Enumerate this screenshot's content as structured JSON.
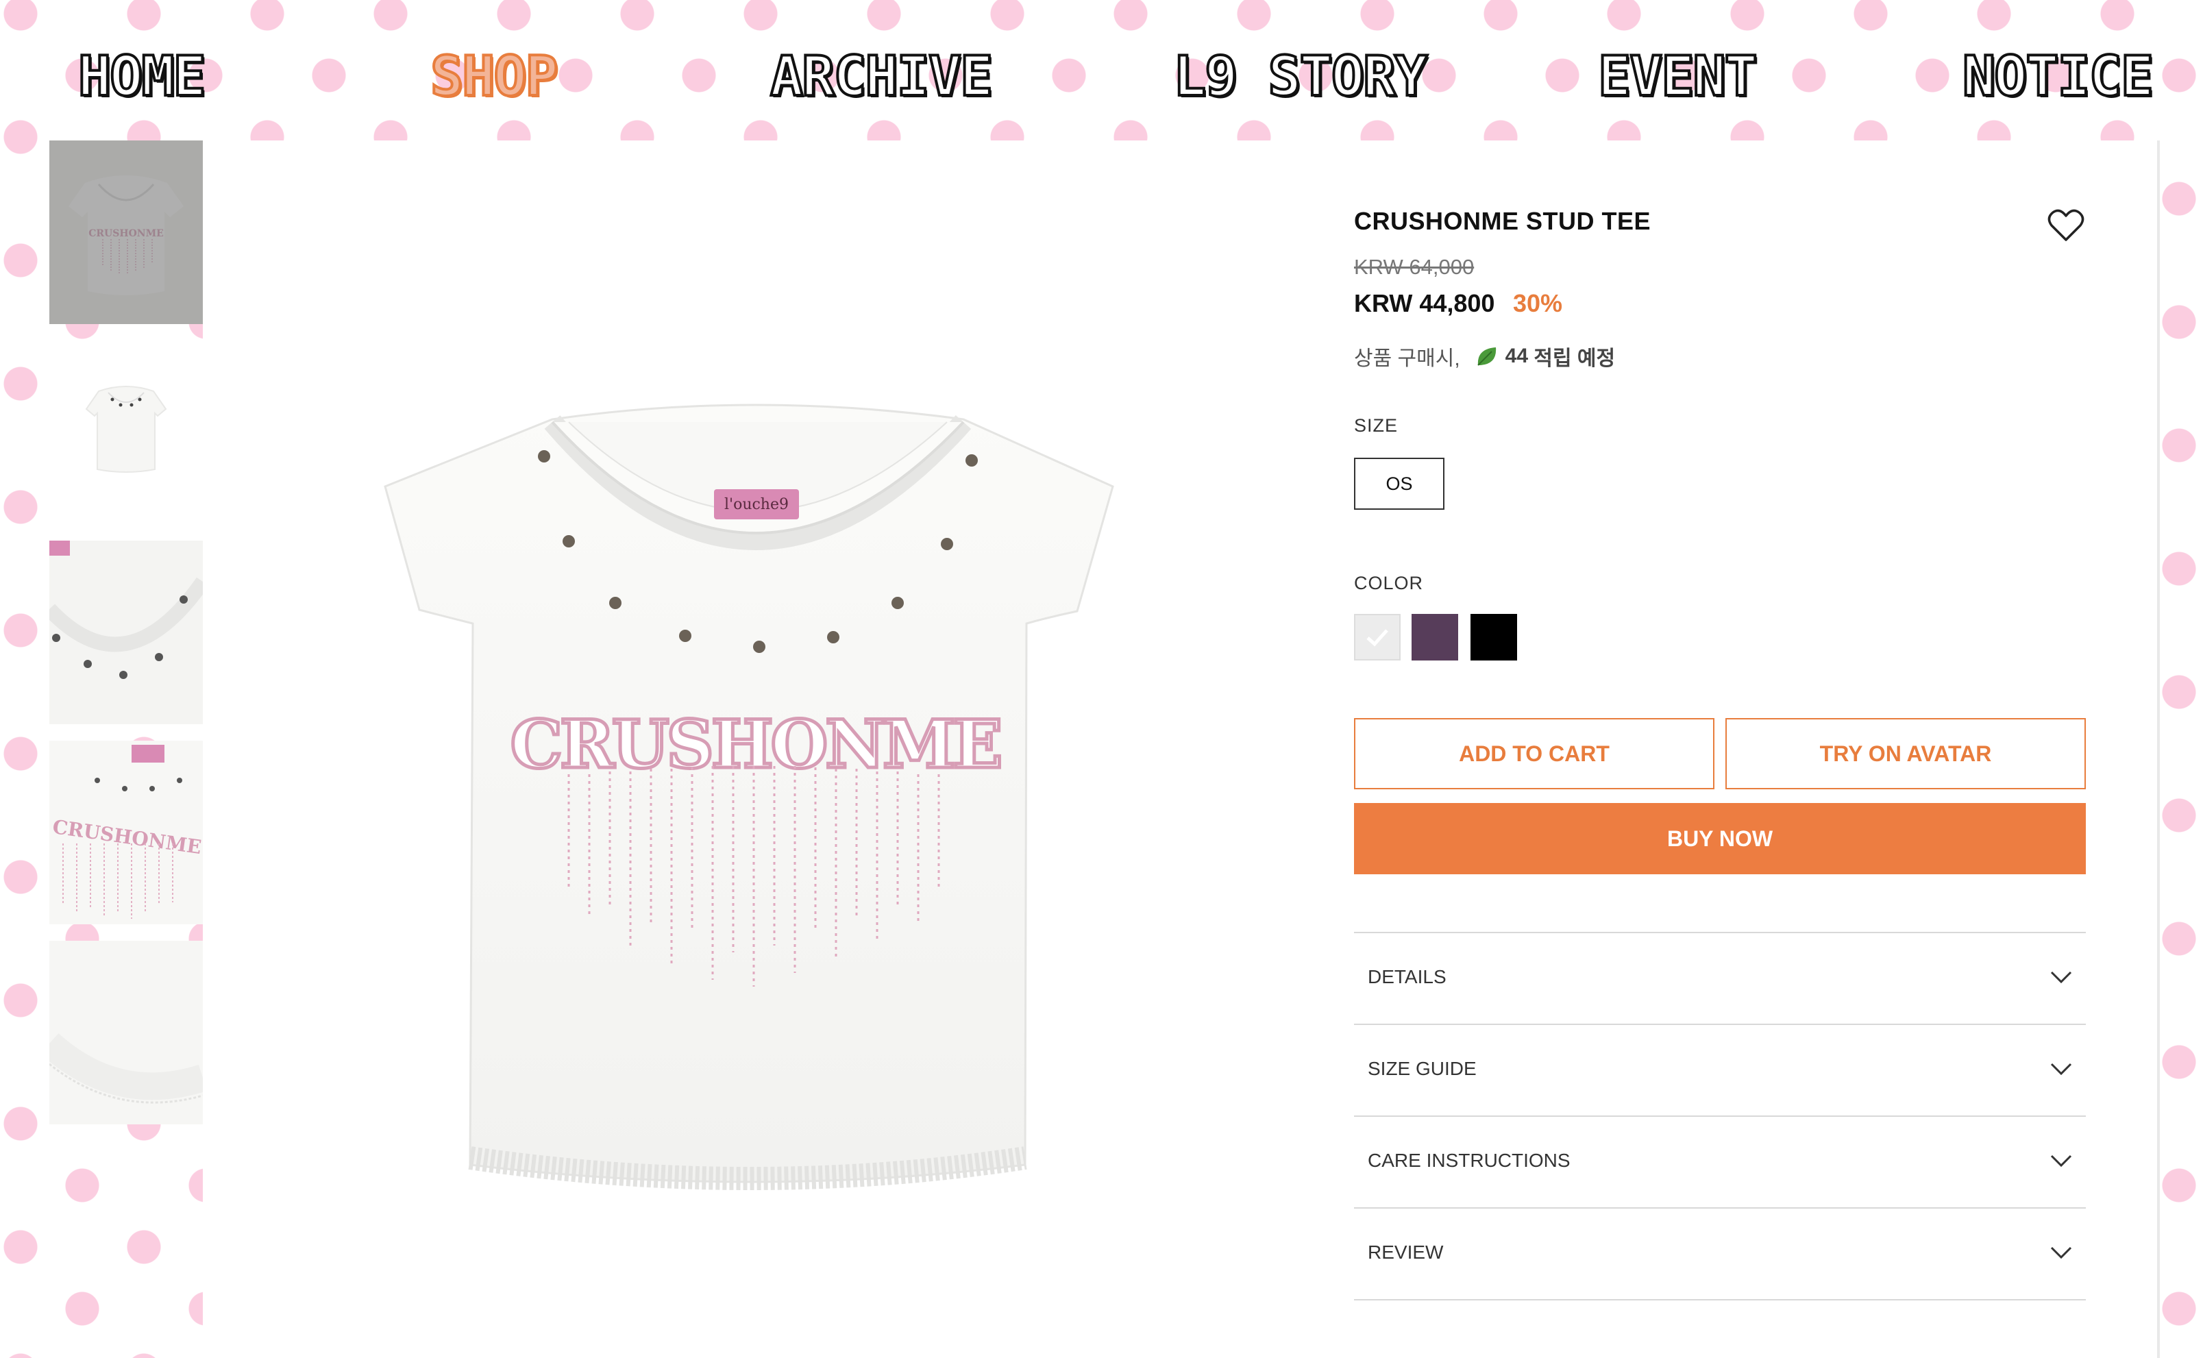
{
  "nav": {
    "items": [
      {
        "label": "HOME",
        "active": false
      },
      {
        "label": "SHOP",
        "active": true
      },
      {
        "label": "ARCHIVE",
        "active": false
      },
      {
        "label": "L9 STORY",
        "active": false
      },
      {
        "label": "EVENT",
        "active": false
      },
      {
        "label": "NOTICE",
        "active": false
      }
    ]
  },
  "product": {
    "title": "CRUSHONME STUD TEE",
    "original_price": "KRW 64,000",
    "sale_price": "KRW 44,800",
    "discount": "30%",
    "points_prefix": "상품 구매시,",
    "points_amount": "44",
    "points_suffix": "적립 예정",
    "size_label": "SIZE",
    "sizes": [
      "OS"
    ],
    "color_label": "COLOR",
    "colors": [
      {
        "name": "white",
        "hex": "#ececec",
        "selected": true
      },
      {
        "name": "purple",
        "hex": "#573d5a",
        "selected": false
      },
      {
        "name": "black",
        "hex": "#000000",
        "selected": false
      }
    ],
    "graphic_text": "CRUSHONME",
    "tag_text": "l'ouche9"
  },
  "actions": {
    "add_to_cart": "ADD TO CART",
    "try_on_avatar": "TRY ON AVATAR",
    "buy_now": "BUY NOW"
  },
  "accordion": [
    "DETAILS",
    "SIZE GUIDE",
    "CARE INSTRUCTIONS",
    "REVIEW"
  ],
  "colors": {
    "accent": "#e87d3d",
    "buy_button": "#ed7d41",
    "polka_dot": "#fbcde0",
    "text": "#111111"
  }
}
